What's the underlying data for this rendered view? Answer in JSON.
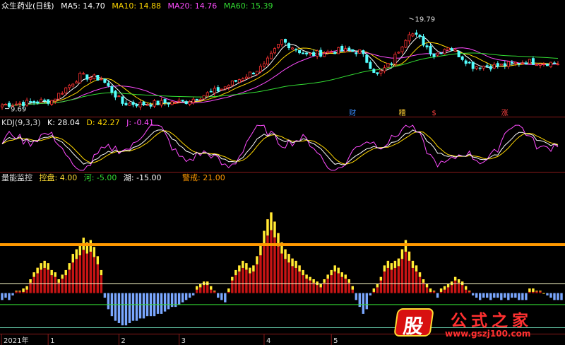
{
  "chart_data": [
    {
      "type": "candlestick",
      "panel": "price",
      "stock_name": "众生药业(日线)",
      "indicators": [
        {
          "name": "MA5",
          "label": "MA5: 14.70",
          "color": "#ffffff"
        },
        {
          "name": "MA10",
          "label": "MA10: 14.88",
          "color": "#ffd700"
        },
        {
          "name": "MA20",
          "label": "MA20: 14.76",
          "color": "#ff4cff"
        },
        {
          "name": "MA60",
          "label": "MA60: 15.39",
          "color": "#33dd33"
        }
      ],
      "price_range": [
        9.2,
        20.6
      ],
      "high_annotation": "19.79",
      "low_annotation": "9.69",
      "event_markers": [
        {
          "label": "财",
          "color": "#3a8cff",
          "index": 99
        },
        {
          "label": "糟",
          "color": "#ffcc33",
          "index": 113
        },
        {
          "label": "$",
          "color": "#ff4040",
          "index": 122
        },
        {
          "label": "涨",
          "color": "#ff4040",
          "index": 142
        }
      ]
    },
    {
      "type": "line",
      "panel": "kdj",
      "title": "KDJ(9,3,3)",
      "series": [
        {
          "name": "K",
          "label": "K: 28.04",
          "color": "#ffffff"
        },
        {
          "name": "D",
          "label": "D: 42.27",
          "color": "#ffd700"
        },
        {
          "name": "J",
          "label": "J: -0.41",
          "color": "#ff4cff"
        }
      ]
    },
    {
      "type": "bar",
      "panel": "volume-energy",
      "title": "量能监控",
      "labels": [
        {
          "name": "控盘",
          "label": "控盘: 4.00",
          "color": "#ffdd33"
        },
        {
          "name": "河",
          "label": "河: -5.00",
          "color": "#33dd33"
        },
        {
          "name": "湖",
          "label": "湖: -15.00",
          "color": "#ffffff"
        },
        {
          "name": "警戒",
          "label": "警戒: 21.00",
          "color": "#ff9900"
        }
      ],
      "reference_lines": [
        {
          "name": "警戒",
          "value": 21,
          "color": "#ff9900"
        },
        {
          "name": "控盘",
          "value": 4,
          "color": "#ffffcc"
        },
        {
          "name": "河",
          "value": -5,
          "color": "#33dd33"
        },
        {
          "name": "湖",
          "value": -15,
          "color": "#66ccaa"
        }
      ],
      "value_range": [
        -17,
        48
      ],
      "values": [
        -3,
        -2,
        -3,
        -1,
        1,
        1,
        2,
        3,
        6,
        9,
        11,
        13,
        14,
        13,
        10,
        9,
        6,
        8,
        10,
        13,
        17,
        19,
        21,
        24,
        22,
        23,
        20,
        16,
        10,
        -2,
        -7,
        -10,
        -12,
        -13,
        -14,
        -14,
        -13,
        -12,
        -12,
        -11,
        -11,
        -10,
        -10,
        -10,
        -9,
        -9,
        -8,
        -7,
        -6,
        -6,
        -5,
        -4,
        -3,
        -2,
        -1,
        3,
        4,
        5,
        5,
        3,
        1,
        -2,
        -3,
        -4,
        2,
        7,
        10,
        12,
        14,
        13,
        11,
        12,
        16,
        21,
        27,
        32,
        35,
        31,
        26,
        22,
        19,
        17,
        15,
        14,
        12,
        10,
        8,
        7,
        6,
        5,
        4,
        6,
        8,
        10,
        12,
        11,
        9,
        8,
        6,
        3,
        -3,
        -6,
        -9,
        -7,
        -1,
        2,
        4,
        7,
        12,
        14,
        13,
        14,
        15,
        19,
        23,
        18,
        14,
        12,
        9,
        6,
        4,
        2,
        1,
        -2,
        2,
        3,
        4,
        5,
        7,
        6,
        5,
        3,
        1,
        -1,
        -2,
        -3,
        -2,
        -2,
        -3,
        -2,
        -2,
        -3,
        -2,
        -3,
        -2,
        -2,
        -3,
        -3,
        -3,
        2,
        2,
        1,
        1,
        0,
        -1,
        -2,
        -3,
        -3,
        -3
      ]
    }
  ],
  "x_axis": {
    "labels": [
      {
        "text": "2021年",
        "index": 0
      },
      {
        "text": "1",
        "index": 13
      },
      {
        "text": "2",
        "index": 33
      },
      {
        "text": "3",
        "index": 50
      },
      {
        "text": "4",
        "index": 74
      },
      {
        "text": "5",
        "index": 93
      }
    ]
  },
  "watermark": {
    "text": "公式之家",
    "url": "www.gszj100.com",
    "logo_char": "股"
  }
}
